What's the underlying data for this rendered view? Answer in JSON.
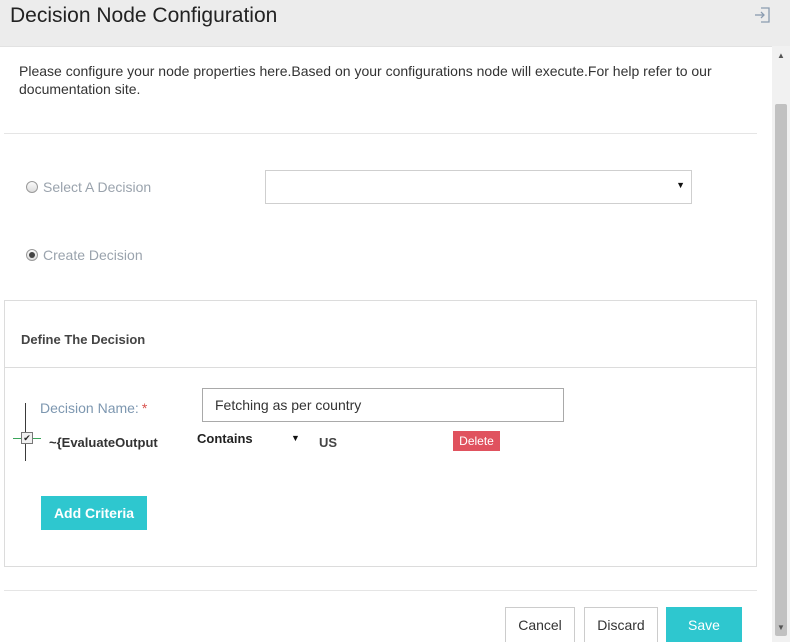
{
  "dialog": {
    "title": "Decision Node Configuration",
    "intro": "Please configure your node properties here.Based on your configurations node will execute.For help refer to our documentation site."
  },
  "mode": {
    "select_label": "Select A Decision",
    "create_label": "Create Decision",
    "selected": "create",
    "select_value": ""
  },
  "definition": {
    "title": "Define The Decision",
    "name_label": "Decision Name:",
    "required_mark": "*",
    "name_value": "Fetching as per country",
    "criteria": [
      {
        "checked": true,
        "variable": "~{EvaluateOutput",
        "operator": "Contains",
        "value": "US",
        "delete_label": "Delete"
      }
    ],
    "add_criteria_label": "Add Criteria"
  },
  "footer": {
    "cancel_label": "Cancel",
    "discard_label": "Discard",
    "save_label": "Save"
  },
  "icons": {
    "exit": "sign-out-icon",
    "select_arrow": "caret-down-icon",
    "check": "check-icon"
  },
  "colors": {
    "accent": "#2ec7cf",
    "danger": "#e0525e",
    "label": "#7d97b0"
  }
}
